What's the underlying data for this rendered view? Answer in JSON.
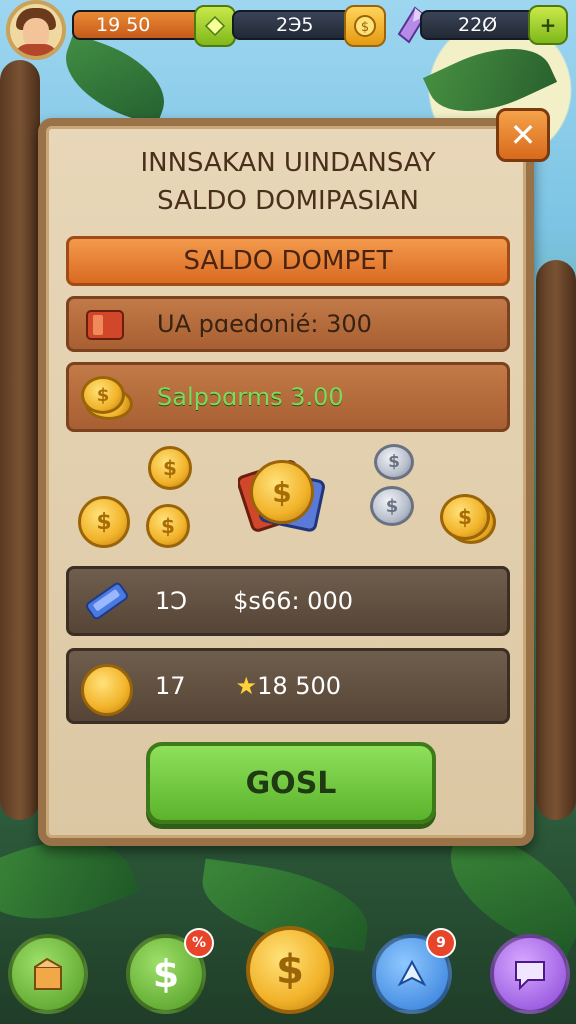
{
  "hud": {
    "resource1_value": "19 50",
    "resource2_value": "2Э5",
    "resource3_value": "22Ø",
    "avatar_icon": "player-portrait",
    "resource1_icon": "lemon-gem-icon",
    "resource2_icon": "gold-coin-icon",
    "resource3_icon": "purple-crystal-icon",
    "resource3_plus": "+"
  },
  "panel": {
    "title_line1": "INNSAKAN UINDANSAY",
    "title_line2": "SALDO DOMIPASIAN",
    "close_label": "✕",
    "banner_label": "SALDO DOMPET",
    "row1_label": "UA pɑedonié: 300",
    "row2_label": "Salpɔɑrms 3.00",
    "row3_count": "1Ɔ",
    "row3_value": "$s66: 000",
    "row4_count": "17",
    "row4_value": "18 500",
    "go_label": "GOSL"
  },
  "nav": {
    "badge_money": "%",
    "badge_map": "9"
  },
  "colors": {
    "panel_bg": "#e3d0ae",
    "banner_orange": "#e8802e",
    "button_green": "#6ec83c",
    "gold": "#f2b32a"
  }
}
